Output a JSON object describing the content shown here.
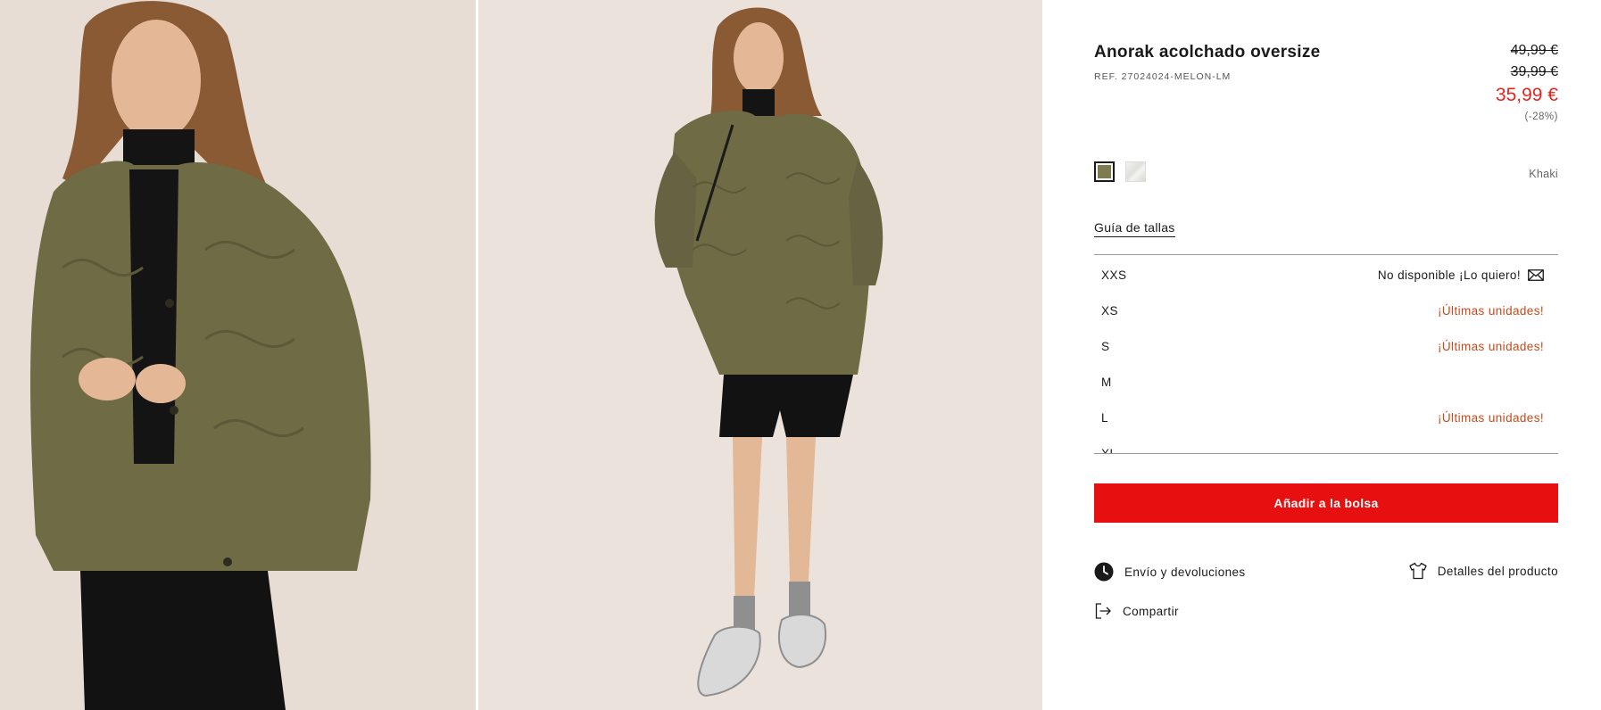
{
  "product": {
    "title": "Anorak acolchado oversize",
    "ref": "REF. 27024024-MELON-LM",
    "price_original": "49,99 €",
    "price_previous": "39,99 €",
    "price_current": "35,99 €",
    "discount": "(-28%)"
  },
  "colors": {
    "selected_name": "Khaki",
    "swatches": [
      {
        "name": "Khaki",
        "hex": "#7d7b4f",
        "selected": true
      },
      {
        "name": "other",
        "hex": "#e6e6e1",
        "selected": false
      }
    ]
  },
  "size_guide_label": "Guía de tallas",
  "sizes": [
    {
      "label": "XXS",
      "status": "No disponible ¡Lo quiero!"
    },
    {
      "label": "XS",
      "status": "¡Últimas unidades!"
    },
    {
      "label": "S",
      "status": "¡Últimas unidades!"
    },
    {
      "label": "M",
      "status": ""
    },
    {
      "label": "L",
      "status": "¡Últimas unidades!"
    },
    {
      "label": "XL",
      "status": ""
    }
  ],
  "add_to_bag_label": "Añadir a la bolsa",
  "links": {
    "shipping": "Envío y devoluciones",
    "details": "Detalles del producto",
    "share": "Compartir"
  },
  "theme": {
    "price_red": "#e0261e",
    "button_red": "#e70f0f",
    "low_stock_orange": "#c9491c",
    "jacket_khaki": "#6f6b45"
  },
  "icons": {
    "shipping": "clock-icon",
    "details": "shirt-icon",
    "share": "share-icon",
    "notify": "mail-icon"
  }
}
